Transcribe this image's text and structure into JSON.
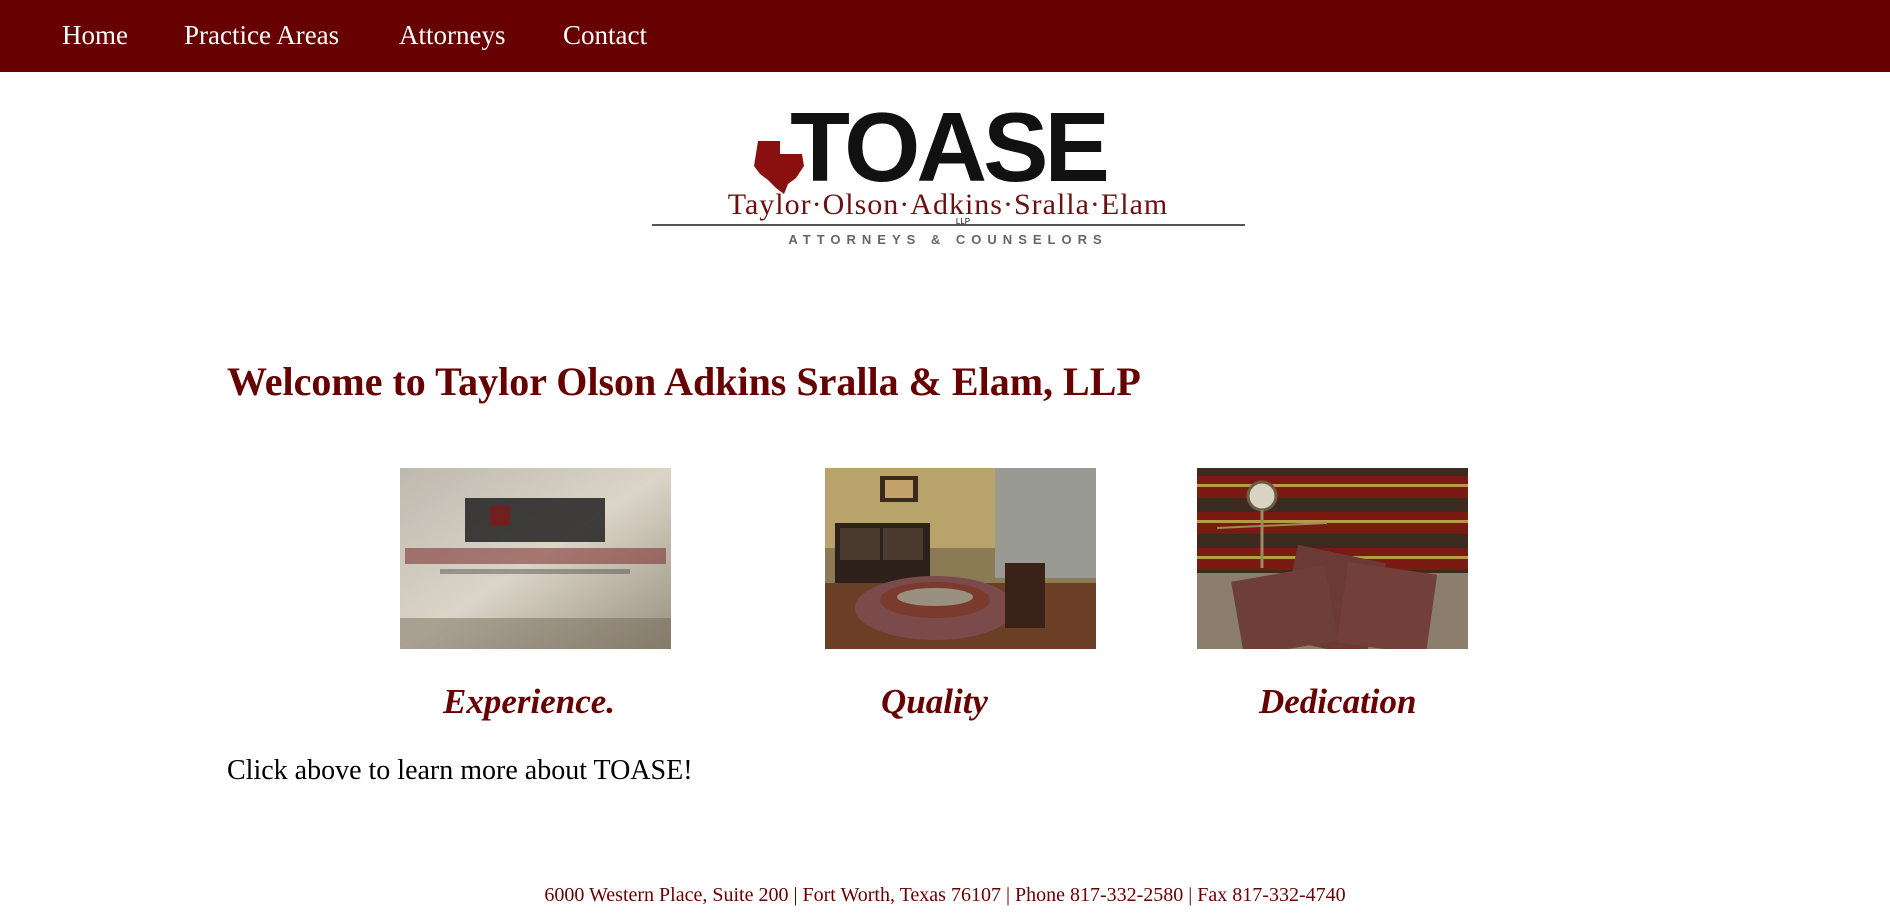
{
  "nav": {
    "items": [
      {
        "label": "Home"
      },
      {
        "label": "Practice Areas"
      },
      {
        "label": "Attorneys"
      },
      {
        "label": "Contact"
      }
    ]
  },
  "logo": {
    "mark": "TOASE",
    "name": "Taylor·Olson·Adkins·Sralla·Elam",
    "llp": "LLP",
    "tagline": "ATTORNEYS & COUNSELORS"
  },
  "main": {
    "title": "Welcome to Taylor Olson Adkins Sralla & Elam, LLP",
    "features": [
      {
        "caption": "Experience.",
        "image": "lobby-glass-wall-logo-photo"
      },
      {
        "caption": "Quality",
        "image": "office-lounge-photo"
      },
      {
        "caption": "Dedication",
        "image": "law-books-and-scales-photo"
      }
    ],
    "cta": "Click above to learn more about TOASE!"
  },
  "footer": {
    "text": "6000 Western Place, Suite 200 | Fort Worth, Texas 76107 | Phone 817-332-2580 | Fax 817-332-4740"
  },
  "colors": {
    "brand": "#670000",
    "background": "#ffffff",
    "nav_text": "#ffffff"
  }
}
